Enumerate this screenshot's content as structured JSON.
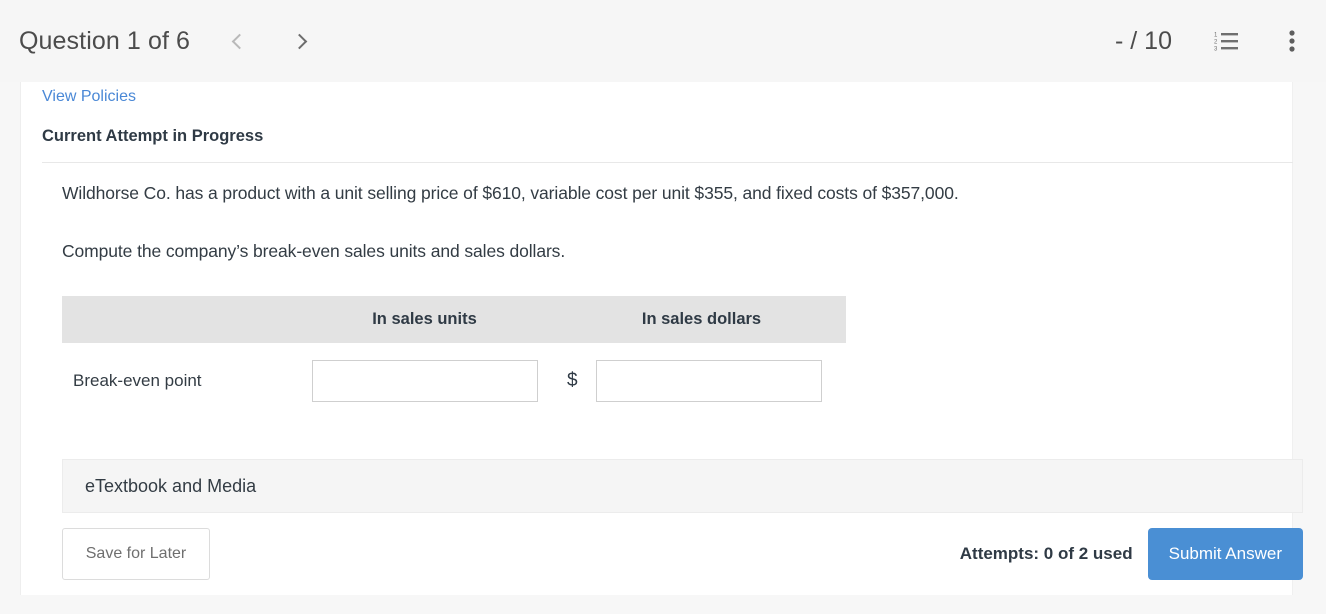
{
  "header": {
    "question_title": "Question 1 of 6",
    "prev_icon": "chevron-left-icon",
    "next_icon": "chevron-right-icon",
    "score": "- / 10",
    "list_icon": "numbered-list-icon",
    "menu_icon": "more-vertical-icon"
  },
  "content": {
    "policies_link": "View Policies",
    "attempt_status": "Current Attempt in Progress",
    "paragraph_1": "Wildhorse Co. has a product with a unit selling price of $610, variable cost per unit $355, and fixed costs of $357,000.",
    "paragraph_2": "Compute the company’s break-even sales units and sales dollars."
  },
  "table": {
    "columns": [
      "",
      "In sales units",
      "In sales dollars"
    ],
    "rows": [
      {
        "label": "Break-even point",
        "units_value": "",
        "units_placeholder": "",
        "currency_symbol": "$",
        "dollars_value": "",
        "dollars_placeholder": ""
      }
    ]
  },
  "etextbook": {
    "label": "eTextbook and Media"
  },
  "footer": {
    "save_label": "Save for Later",
    "attempts_text": "Attempts: 0 of 2 used",
    "submit_label": "Submit Answer"
  },
  "colors": {
    "link_blue": "#4a88d6",
    "submit_blue": "#4a8fd4",
    "header_bg": "#f6f6f6",
    "table_header_bg": "#e3e3e3",
    "etextbook_bg": "#f5f5f5",
    "text_dark": "#2f3a45"
  }
}
